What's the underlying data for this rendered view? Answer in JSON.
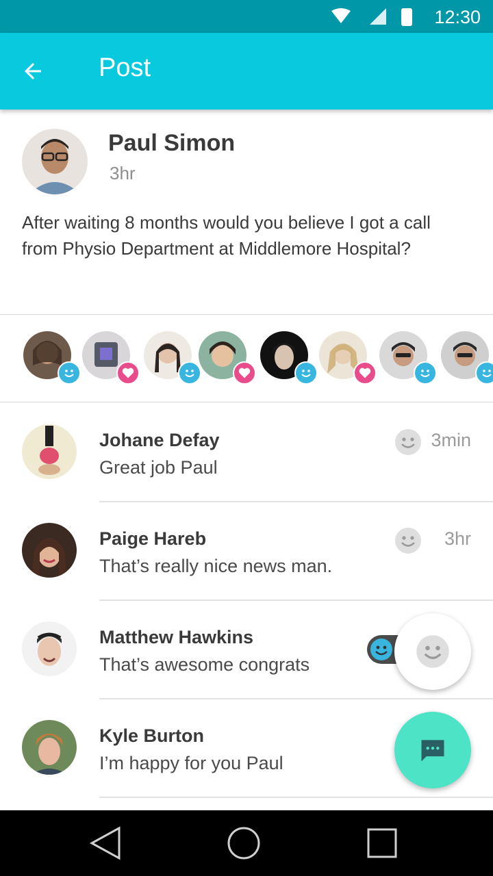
{
  "status_bar": {
    "time": "12:30",
    "icons": [
      "wifi-icon",
      "signal-icon",
      "battery-icon"
    ]
  },
  "app_bar": {
    "title": "Post",
    "back_icon": "arrow-back-icon"
  },
  "post": {
    "author": "Paul Simon",
    "time": "3hr",
    "text": "After waiting 8 months would you believe I got a call from Physio Department at Middlemore Hospital?"
  },
  "reactions": [
    {
      "type": "smile"
    },
    {
      "type": "heart"
    },
    {
      "type": "smile"
    },
    {
      "type": "heart"
    },
    {
      "type": "smile"
    },
    {
      "type": "heart"
    },
    {
      "type": "smile"
    },
    {
      "type": "smile"
    }
  ],
  "comments": [
    {
      "name": "Johane Defay",
      "text": "Great job Paul",
      "time": "3min"
    },
    {
      "name": "Paige Hareb",
      "text": "That’s really nice news man.",
      "time": "3hr"
    },
    {
      "name": "Matthew Hawkins",
      "text": "That’s awesome congrats",
      "time": ""
    },
    {
      "name": "Kyle Burton",
      "text": "I’m happy for you Paul",
      "time": ""
    }
  ],
  "colors": {
    "status_bar": "#0098a8",
    "app_bar": "#08c9dd",
    "fab_chat": "#4de3c6",
    "smile_badge": "#39b6e0",
    "heart_badge": "#e84c8b"
  },
  "nav": {
    "icons": [
      "back-triangle-icon",
      "home-circle-icon",
      "recents-square-icon"
    ]
  }
}
